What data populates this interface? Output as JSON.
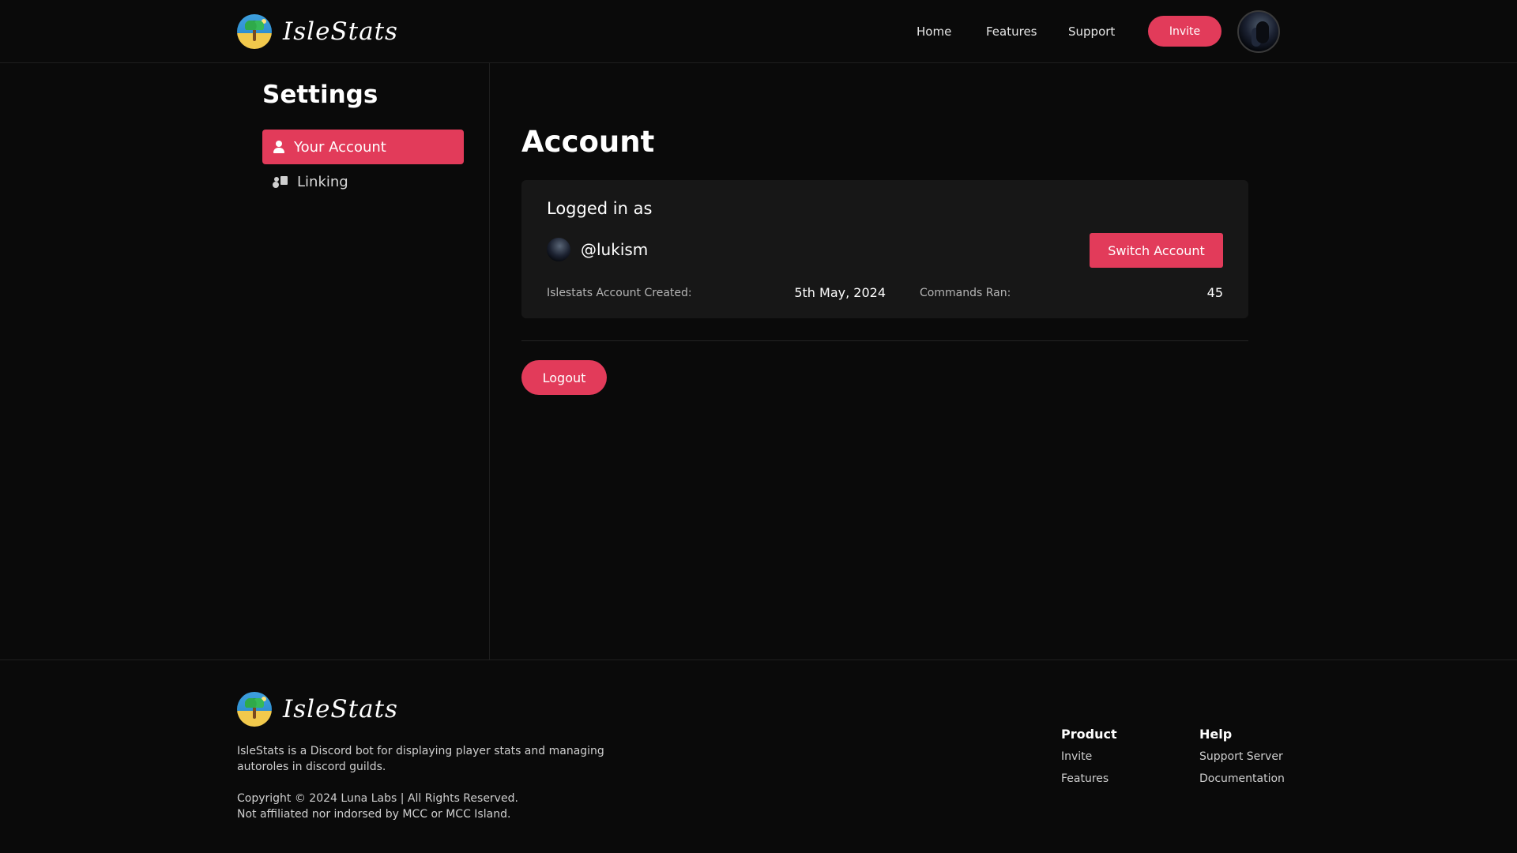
{
  "header": {
    "brand": "IsleStats",
    "nav": {
      "home": "Home",
      "features": "Features",
      "support": "Support"
    },
    "invite": "Invite"
  },
  "sidebar": {
    "title": "Settings",
    "items": [
      {
        "label": "Your Account",
        "icon": "user-icon",
        "active": true
      },
      {
        "label": "Linking",
        "icon": "user-card-icon",
        "active": false
      }
    ]
  },
  "main": {
    "title": "Account",
    "card": {
      "logged_in_label": "Logged in as",
      "username": "@lukism",
      "switch_button": "Switch Account",
      "created_label": "Islestats Account Created:",
      "created_value": "5th May, 2024",
      "commands_label": "Commands Ran:",
      "commands_value": "45"
    },
    "logout": "Logout"
  },
  "footer": {
    "brand": "IsleStats",
    "description": "IsleStats is a Discord bot for displaying player stats and managing autoroles in discord guilds.",
    "copyright": "Copyright © 2024 Luna Labs | All Rights Reserved.",
    "disclaimer": "Not affiliated nor indorsed by MCC or MCC Island.",
    "product": {
      "title": "Product",
      "links": [
        "Invite",
        "Features"
      ]
    },
    "help": {
      "title": "Help",
      "links": [
        "Support Server",
        "Documentation"
      ]
    }
  },
  "colors": {
    "accent": "#e23b5a",
    "background": "#0a0a0a",
    "card": "#171717"
  }
}
